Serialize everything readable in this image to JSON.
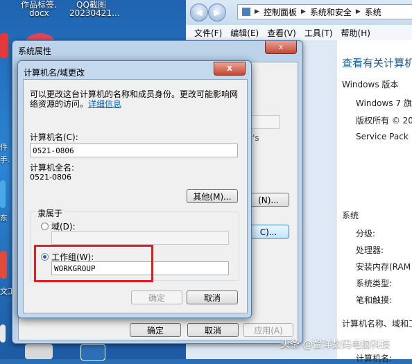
{
  "desktop": {
    "items": [
      {
        "label": "作品标签.",
        "x_note": "top-left"
      },
      {
        "label": "docx"
      },
      {
        "label": "QQ截图"
      },
      {
        "label": "20230421..."
      }
    ],
    "partial_labels": [
      "件",
      "手.",
      "东",
      "文工"
    ]
  },
  "explorer": {
    "address": {
      "segments": [
        "控制面板",
        "系统和安全",
        "系统"
      ]
    },
    "menu": [
      "文件(F)",
      "编辑(E)",
      "查看(V)",
      "工具(T)",
      "帮助(H)"
    ],
    "heading": "查看有关计算机",
    "windows_version_label": "Windows 版本",
    "windows_edition": "Windows 7 旗",
    "copyright": "版权所有 © 20",
    "service_pack": "Service Pack 1",
    "system_label": "系统",
    "rows": [
      "分级:",
      "处理器:",
      "安装内存(RAM",
      "系统类型:",
      "笔和触摸:"
    ],
    "name_section": "计算机名称、域和工",
    "name_label": "计算机名:"
  },
  "system_properties": {
    "title": "系统属性",
    "close": "x",
    "partial_text_1": "y's",
    "partial_button_1": "(N)...",
    "partial_button_2": "C)...",
    "ok": "确定",
    "cancel": "取消",
    "apply": "应用(A)"
  },
  "computer_name_dialog": {
    "title": "计算机名/域更改",
    "close": "x",
    "description_line1": "可以更改这台计算机的名称和成员身份。更改可能影响网",
    "description_line2": "络资源的访问。",
    "details_link": "详细信息",
    "computer_name_label": "计算机名(C):",
    "computer_name_value": "0521-0806",
    "full_name_label": "计算机全名:",
    "full_name_value": "0521-0806",
    "other_button": "其他(M)...",
    "member_of_label": "隶属于",
    "domain_label": "域(D):",
    "domain_value": "",
    "workgroup_label": "工作组(W):",
    "workgroup_value": "WORKGROUP",
    "ok": "确定",
    "cancel": "取消"
  },
  "watermark": "头条 @智洋数码电脑科技",
  "colors": {
    "highlight_box": "#e02020",
    "link": "#0066cc",
    "explorer_heading": "#1e5a96"
  }
}
